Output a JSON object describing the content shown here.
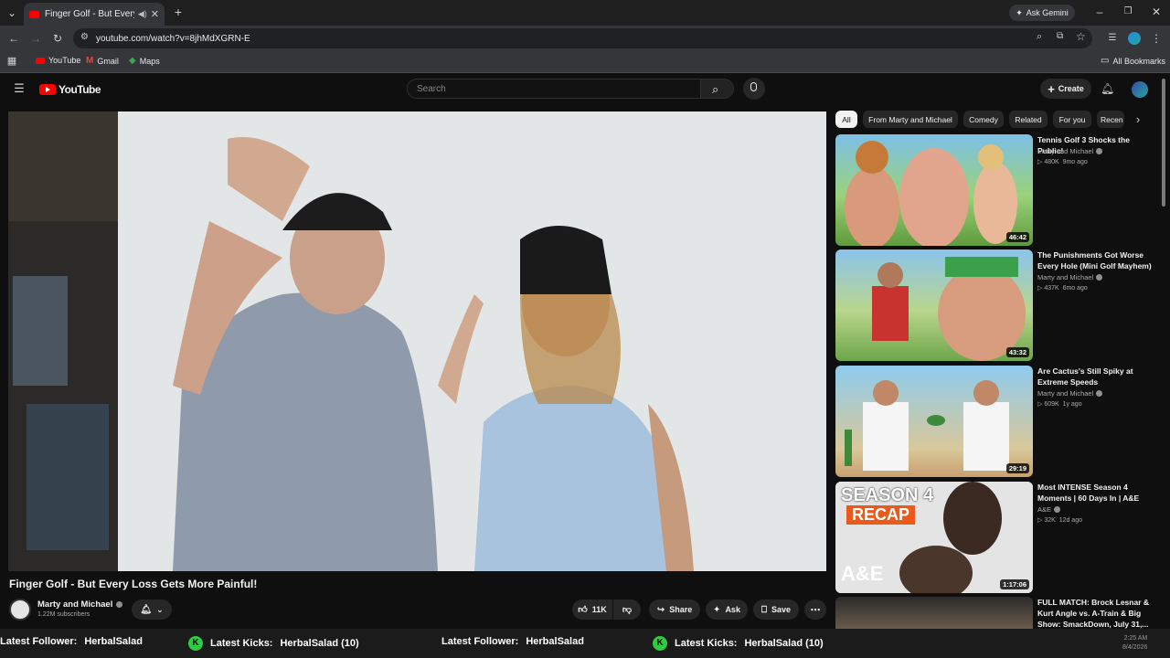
{
  "browser": {
    "tab_title": "Finger Golf - But Every Loss",
    "gemini_label": "Ask Gemini",
    "url": "youtube.com/watch?v=8jhMdXGRN-E",
    "bookmarks": [
      {
        "label": "YouTube"
      },
      {
        "label": "Gmail"
      },
      {
        "label": "Maps"
      }
    ],
    "all_bookmarks": "All Bookmarks"
  },
  "youtube": {
    "logo_text": "YouTube",
    "search_placeholder": "Search",
    "create_label": "Create"
  },
  "video": {
    "title": "Finger Golf - But Every Loss Gets More Painful!",
    "channel": "Marty and Michael",
    "subscribers": "1.22M subscribers",
    "likes": "11K",
    "share_label": "Share",
    "ask_label": "Ask",
    "save_label": "Save"
  },
  "chips": [
    {
      "label": "All",
      "active": true
    },
    {
      "label": "From Marty and Michael"
    },
    {
      "label": "Comedy"
    },
    {
      "label": "Related"
    },
    {
      "label": "For you"
    },
    {
      "label": "Recen"
    }
  ],
  "recommendations": [
    {
      "title": "Tennis Golf 3 Shocks the Public!",
      "channel": "Marty and Michael",
      "views": "480K",
      "age": "9mo ago",
      "duration": "46:42"
    },
    {
      "title": "The Punishments Got Worse Every Hole (Mini Golf Mayhem)",
      "channel": "Marty and Michael",
      "views": "437K",
      "age": "6mo ago",
      "duration": "43:32"
    },
    {
      "title": "Are Cactus's Still Spiky at Extreme Speeds",
      "channel": "Marty and Michael",
      "views": "609K",
      "age": "1y ago",
      "duration": "29:19"
    },
    {
      "title": "Most INTENSE Season 4 Moments | 60 Days In | A&E",
      "channel": "A&E",
      "views": "32K",
      "age": "12d ago",
      "duration": "1:17:06",
      "thumb_text_1": "SEASON 4",
      "thumb_text_2": "RECAP",
      "thumb_logo": "A&E"
    },
    {
      "title": "FULL MATCH: Brock Lesnar & Kurt Angle vs. A-Train & Big Show: SmackDown, July 31,...",
      "channel": "",
      "views": "",
      "age": "",
      "duration": ""
    }
  ],
  "ticker": {
    "item1_label": "Latest Follower:",
    "item1_value": "HerbalSalad",
    "item2_label": "Latest Kicks:",
    "item2_value": "HerbalSalad (10)",
    "item3_label": "Latest Follower:",
    "item3_value": "HerbalSalad",
    "item4_label": "Latest Kicks:",
    "item4_value": "HerbalSalad (10)"
  },
  "clock": {
    "time": "2:25 AM",
    "date": "8/4/2026"
  },
  "colors": {
    "brand_red": "#ff0000",
    "background": "#0f0f0f",
    "chip_bg": "#272727",
    "kick_green": "#2ecc40"
  }
}
